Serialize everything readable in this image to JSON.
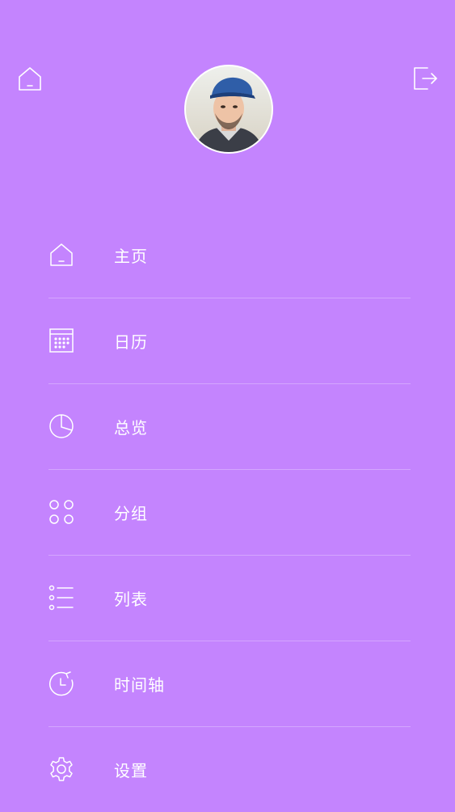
{
  "header": {
    "home_icon": "home-icon",
    "logout_icon": "logout-icon"
  },
  "profile": {
    "avatar": "user-avatar"
  },
  "menu": {
    "items": [
      {
        "label": "主页",
        "icon": "home-icon"
      },
      {
        "label": "日历",
        "icon": "calendar-icon"
      },
      {
        "label": "总览",
        "icon": "pie-chart-icon"
      },
      {
        "label": "分组",
        "icon": "group-grid-icon"
      },
      {
        "label": "列表",
        "icon": "list-icon"
      },
      {
        "label": "时间轴",
        "icon": "timeline-clock-icon"
      },
      {
        "label": "设置",
        "icon": "gear-icon"
      }
    ]
  },
  "colors": {
    "background": "#c484fe",
    "foreground": "#ffffff"
  }
}
